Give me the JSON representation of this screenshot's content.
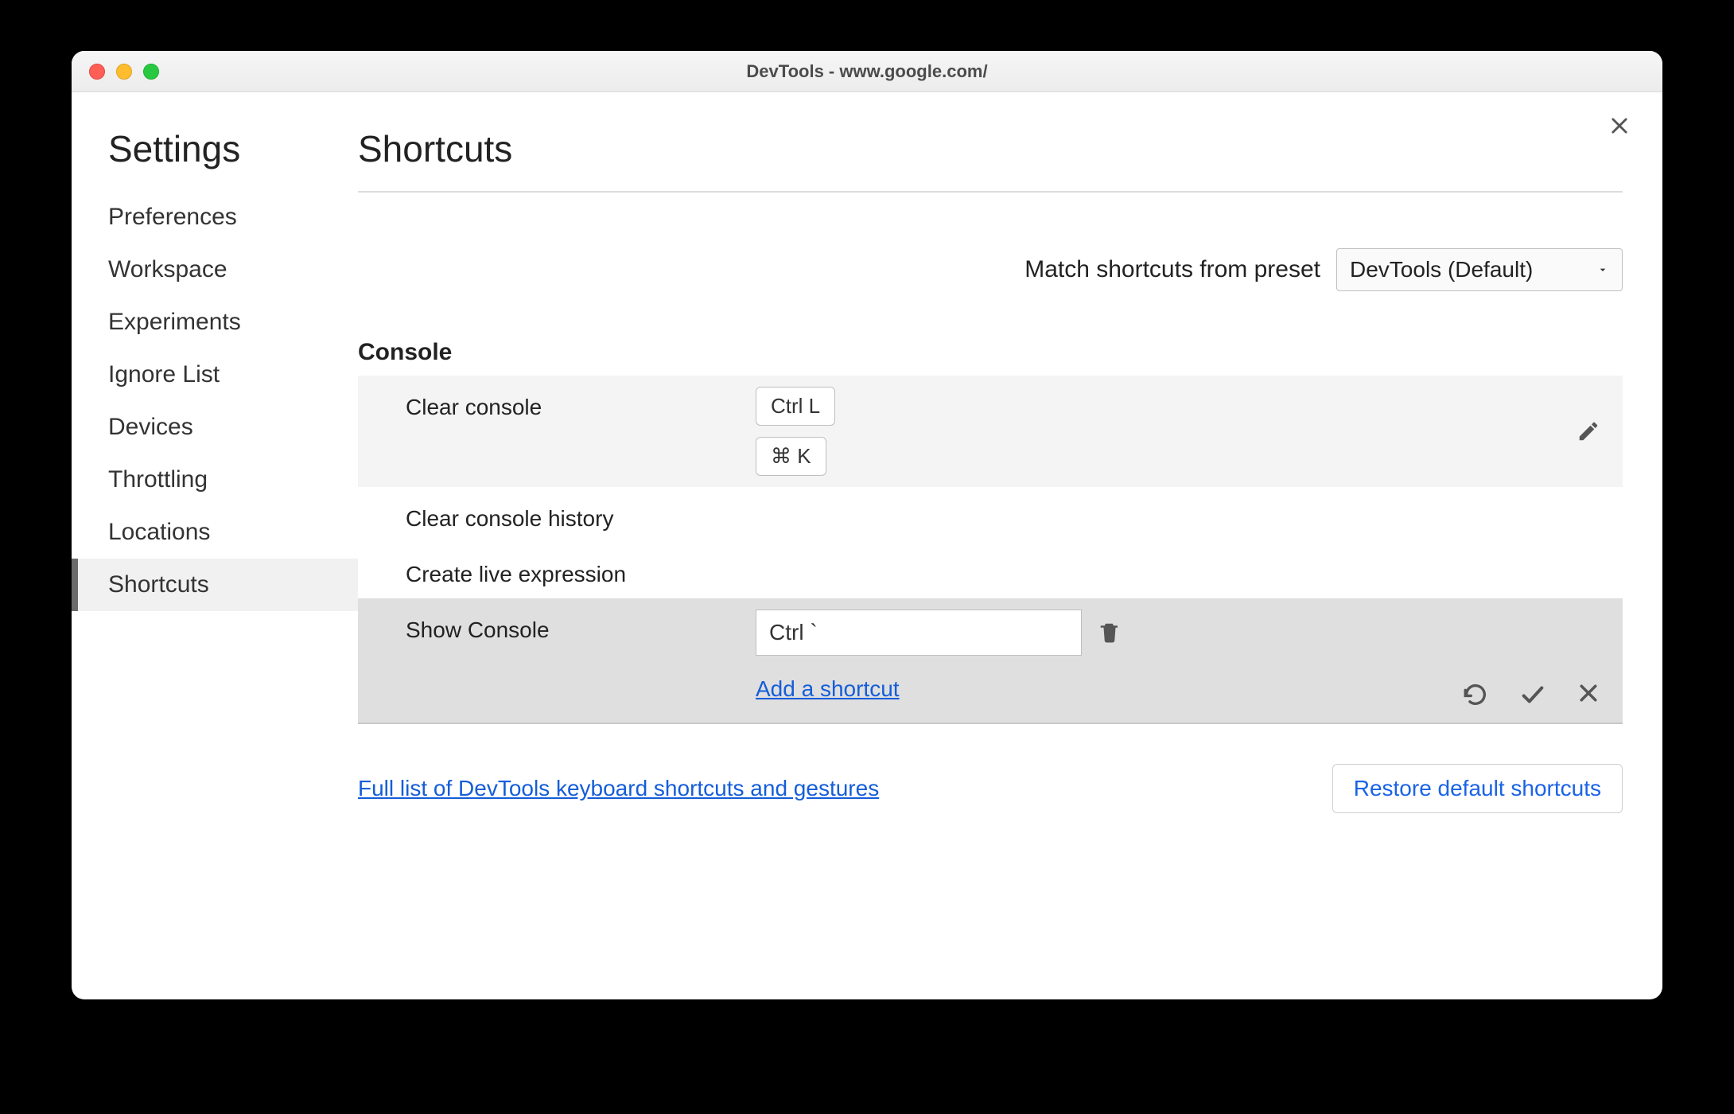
{
  "window": {
    "title": "DevTools - www.google.com/"
  },
  "sidebar": {
    "title": "Settings",
    "items": [
      {
        "label": "Preferences"
      },
      {
        "label": "Workspace"
      },
      {
        "label": "Experiments"
      },
      {
        "label": "Ignore List"
      },
      {
        "label": "Devices"
      },
      {
        "label": "Throttling"
      },
      {
        "label": "Locations"
      },
      {
        "label": "Shortcuts"
      }
    ],
    "active_index": 7
  },
  "main": {
    "title": "Shortcuts",
    "preset_label": "Match shortcuts from preset",
    "preset_value": "DevTools (Default)",
    "section": {
      "heading": "Console",
      "rows": [
        {
          "label": "Clear console",
          "keys": [
            "Ctrl L",
            "⌘ K"
          ],
          "mode": "hover"
        },
        {
          "label": "Clear console history",
          "keys": [],
          "mode": "plain"
        },
        {
          "label": "Create live expression",
          "keys": [],
          "mode": "plain"
        },
        {
          "label": "Show Console",
          "keys": [
            "Ctrl `"
          ],
          "mode": "editing"
        }
      ]
    },
    "add_shortcut": "Add a shortcut",
    "full_list_link": "Full list of DevTools keyboard shortcuts and gestures",
    "restore_button": "Restore default shortcuts"
  }
}
